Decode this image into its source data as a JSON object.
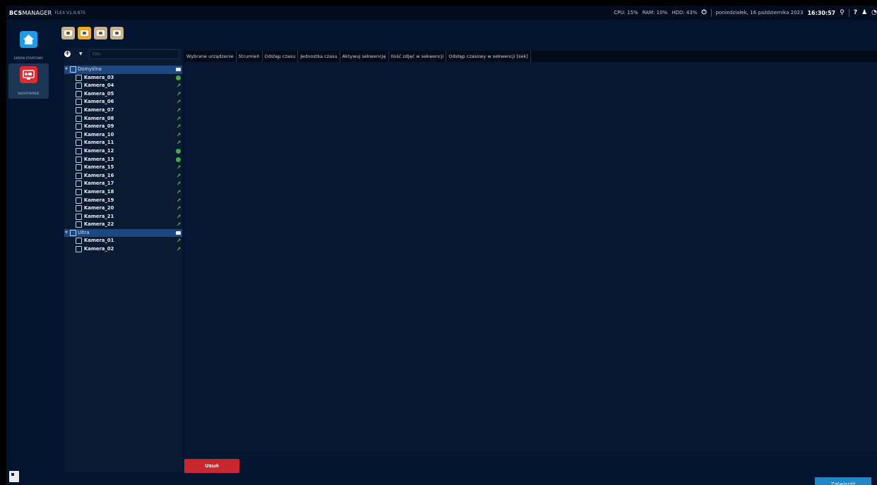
{
  "app": {
    "brand_bold": "BCS",
    "brand_rest": "MANAGER",
    "version": "FLEX V1.9.875"
  },
  "sysinfo": {
    "cpu": "CPU: 15%",
    "ram": "RAM: 10%",
    "hdd": "HDD: 43%",
    "date": "poniedziałek, 16 października 2023",
    "time": "16:30:57",
    "help": "?"
  },
  "nav": [
    {
      "label": "EKRAN STARTOWY",
      "icon": "home-icon"
    },
    {
      "label": "NAGRYWANIE",
      "icon": "recording-icon"
    }
  ],
  "mode_tabs": [
    {
      "icon": "camera-icon",
      "active": false
    },
    {
      "icon": "snapshot-icon",
      "active": true
    },
    {
      "icon": "record-icon",
      "active": false
    },
    {
      "icon": "archive-icon",
      "active": false
    }
  ],
  "filter": {
    "placeholder": "Filtr",
    "value": ""
  },
  "tree": {
    "groups": [
      {
        "label": "Domyślna",
        "items": [
          {
            "label": "Kamera_03",
            "status": "camera"
          },
          {
            "label": "Kamera_04",
            "status": "network"
          },
          {
            "label": "Kamera_05",
            "status": "network"
          },
          {
            "label": "Kamera_06",
            "status": "network"
          },
          {
            "label": "Kamera_07",
            "status": "network"
          },
          {
            "label": "Kamera_08",
            "status": "network"
          },
          {
            "label": "Kamera_09",
            "status": "network"
          },
          {
            "label": "Kamera_10",
            "status": "network"
          },
          {
            "label": "Kamera_11",
            "status": "network"
          },
          {
            "label": "Kamera_12",
            "status": "camera"
          },
          {
            "label": "Kamera_13",
            "status": "camera"
          },
          {
            "label": "Kamera_15",
            "status": "network"
          },
          {
            "label": "Kamera_16",
            "status": "network"
          },
          {
            "label": "Kamera_17",
            "status": "network"
          },
          {
            "label": "Kamera_18",
            "status": "network"
          },
          {
            "label": "Kamera_19",
            "status": "network"
          },
          {
            "label": "Kamera_20",
            "status": "network"
          },
          {
            "label": "Kamera_21",
            "status": "network"
          },
          {
            "label": "Kamera_22",
            "status": "network"
          }
        ]
      },
      {
        "label": "Ultra",
        "items": [
          {
            "label": "Kamera_01",
            "status": "network"
          },
          {
            "label": "Kamera_02",
            "status": "network"
          }
        ]
      }
    ]
  },
  "grid": {
    "columns": [
      "Wybrane urządzenie",
      "Strumień",
      "Odstęp czasu",
      "Jednostka czasu",
      "Aktywuj sekwencję",
      "Ilość zdjęć w sekwencji",
      "Odstęp czasowy w sekwencji [sek]"
    ]
  },
  "buttons": {
    "delete": "Usuń",
    "confirm": "Zatwierdź"
  },
  "colors": {
    "background": "#031430",
    "accent": "#1f87c7",
    "danger": "#c9262d",
    "status_green": "#48c54c",
    "active_tab": "#f5a623"
  }
}
